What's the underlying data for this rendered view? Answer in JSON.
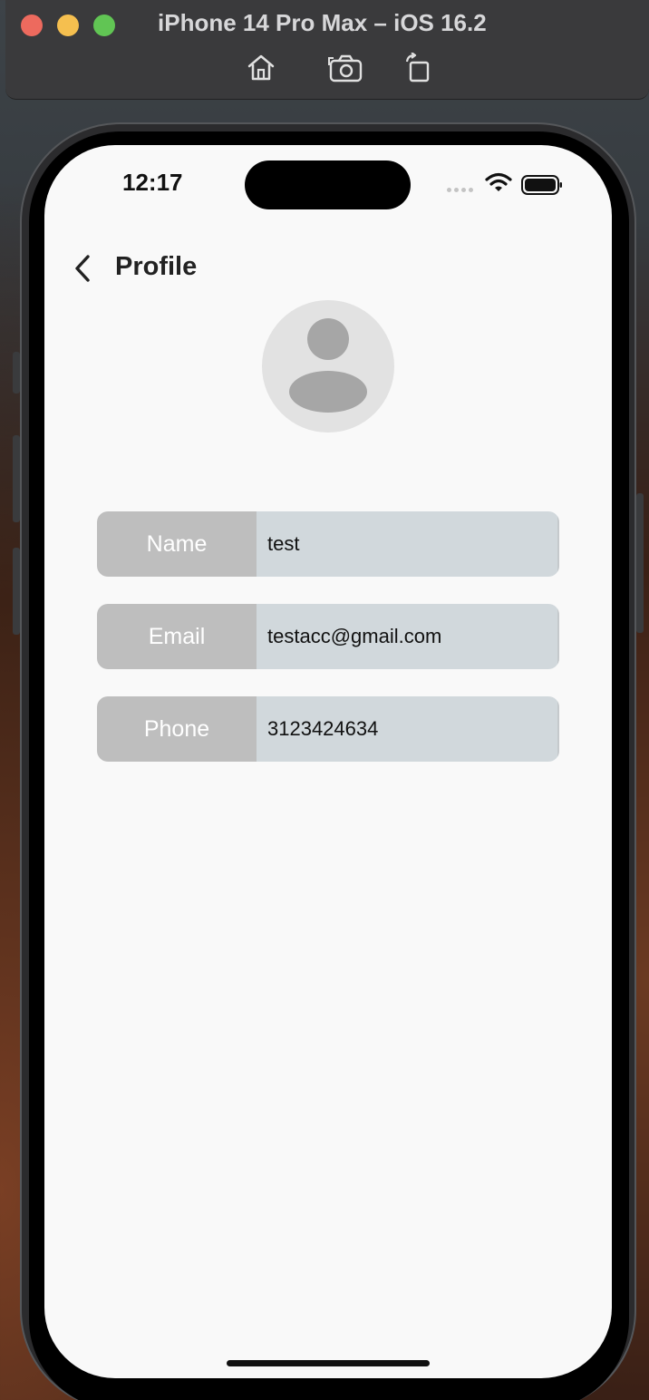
{
  "simulator": {
    "title": "iPhone 14 Pro Max – iOS 16.2",
    "toolbar_icons": [
      "home-icon",
      "screenshot-icon",
      "rotate-icon"
    ]
  },
  "status_bar": {
    "time": "12:17",
    "icons": [
      "signal-dots-icon",
      "wifi-icon",
      "battery-icon"
    ]
  },
  "app_bar": {
    "back_icon": "chevron-left-icon",
    "title": "Profile"
  },
  "avatar": {
    "icon": "person-placeholder-icon"
  },
  "fields": [
    {
      "label": "Name",
      "value": "test"
    },
    {
      "label": "Email",
      "value": "testacc@gmail.com"
    },
    {
      "label": "Phone",
      "value": "3123424634"
    }
  ],
  "colors": {
    "label_bg": "#bebebe",
    "value_bg": "#d1d8dc",
    "screen_bg": "#f9f9f9"
  }
}
